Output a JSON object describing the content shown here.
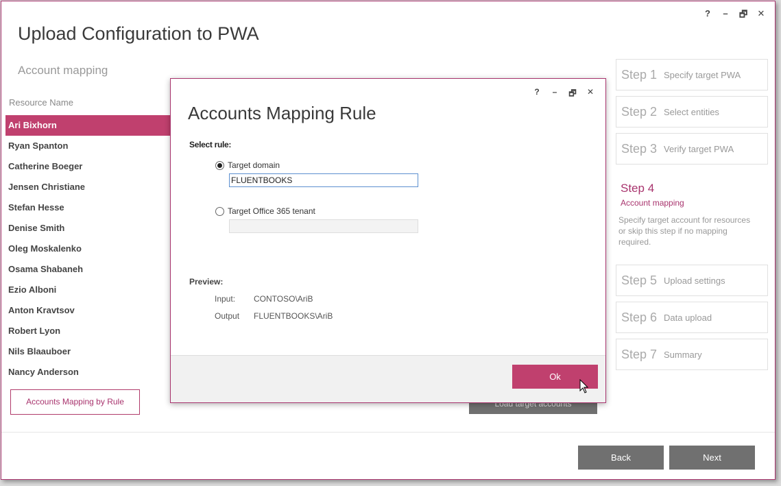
{
  "window": {
    "title": "Upload Configuration to PWA",
    "subtitle": "Account mapping",
    "controls": {
      "help": "?",
      "minimize": "–",
      "restore": "🗗",
      "close": "✕"
    }
  },
  "resources": {
    "header": "Resource Name",
    "items": [
      "Ari Bixhorn",
      "Ryan Spanton",
      "Catherine Boeger",
      "Jensen Christiane",
      "Stefan Hesse",
      "Denise Smith",
      "Oleg Moskalenko",
      "Osama Shabaneh",
      "Ezio Alboni",
      "Anton Kravtsov",
      "Robert Lyon",
      "Nils Blaauboer",
      "Nancy Anderson"
    ],
    "selected_index": 0
  },
  "buttons": {
    "mapping_by_rule": "Accounts Mapping by Rule",
    "load_target": "Load target accounts",
    "back": "Back",
    "next": "Next"
  },
  "steps": [
    {
      "num": "Step 1",
      "label": "Specify target PWA"
    },
    {
      "num": "Step 2",
      "label": "Select entities"
    },
    {
      "num": "Step 3",
      "label": "Verify target PWA"
    },
    {
      "num": "Step 4",
      "label": "Account mapping",
      "description": "Specify target account for resources or skip this step if no mapping required."
    },
    {
      "num": "Step 5",
      "label": "Upload settings"
    },
    {
      "num": "Step 6",
      "label": "Data upload"
    },
    {
      "num": "Step 7",
      "label": "Summary"
    }
  ],
  "dialog": {
    "title": "Accounts Mapping Rule",
    "select_rule_label": "Select rule:",
    "option_domain": "Target domain",
    "domain_value": "FLUENTBOOKS",
    "option_tenant": "Target Office 365 tenant",
    "selected_option": "domain",
    "preview_label": "Preview:",
    "preview_input_key": "Input:",
    "preview_input_value": "CONTOSO\\AriB",
    "preview_output_key": "Output",
    "preview_output_value": "FLUENTBOOKS\\AriB",
    "ok": "Ok",
    "controls": {
      "help": "?",
      "minimize": "–",
      "restore": "🗗",
      "close": "✕"
    }
  },
  "colors": {
    "accent": "#c0406e",
    "border": "#a8336d",
    "button_gray": "#707070"
  }
}
